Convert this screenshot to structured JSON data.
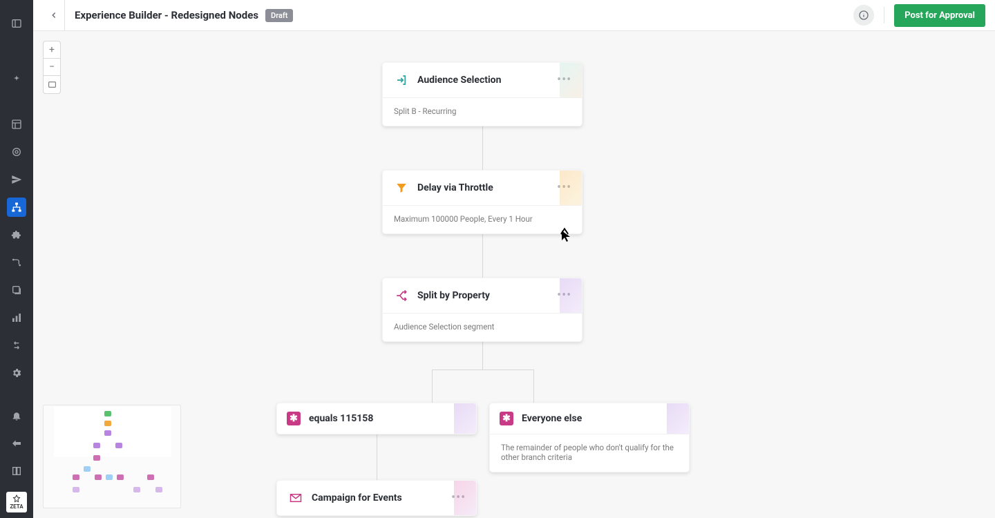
{
  "header": {
    "title": "Experience Builder - Redesigned Nodes",
    "status_badge": "Draft",
    "cta_label": "Post for Approval"
  },
  "brand": {
    "short": "ZETA"
  },
  "zoom": {
    "in": "+",
    "out": "−"
  },
  "nodes": {
    "audience": {
      "title": "Audience Selection",
      "subtitle": "Split B - Recurring"
    },
    "delay": {
      "title": "Delay via Throttle",
      "subtitle": "Maximum 100000 People, Every 1 Hour"
    },
    "split": {
      "title": "Split by Property",
      "subtitle": "Audience Selection segment"
    },
    "branch_a": {
      "title": "equals 115158"
    },
    "branch_b": {
      "title": "Everyone else",
      "subtitle": "The remainder of people who don't qualify for the other branch criteria"
    },
    "campaign": {
      "title": "Campaign for Events"
    }
  },
  "icons": {
    "asterisk": "✱",
    "ellipsis": "•••"
  }
}
